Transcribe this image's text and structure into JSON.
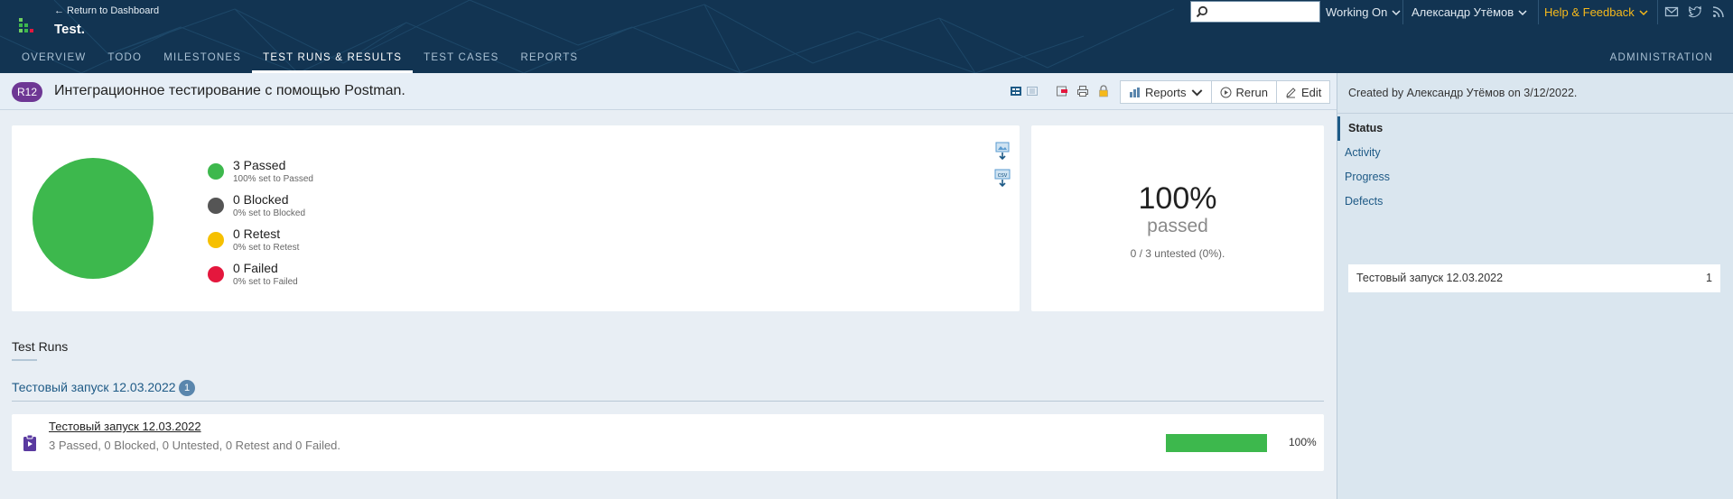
{
  "header": {
    "return_link": "← Return to Dashboard",
    "project_title": "Test.",
    "nav": [
      {
        "label": "OVERVIEW"
      },
      {
        "label": "TODO"
      },
      {
        "label": "MILESTONES"
      },
      {
        "label": "TEST RUNS & RESULTS"
      },
      {
        "label": "TEST CASES"
      },
      {
        "label": "REPORTS"
      }
    ],
    "active_nav": "TEST RUNS & RESULTS",
    "admin": "ADMINISTRATION",
    "search": {
      "value": "",
      "placeholder": ""
    },
    "working_on": "Working On",
    "user": "Александр Утёмов",
    "help": "Help & Feedback",
    "icons": [
      "mail-icon",
      "twitter-icon",
      "rss-icon"
    ]
  },
  "titlebar": {
    "badge": "R12",
    "title": "Интеграционное тестирование с помощью Postman.",
    "reports": "Reports",
    "rerun": "Rerun",
    "edit": "Edit"
  },
  "status_chart": {
    "legend": [
      {
        "label": "3 Passed",
        "sub": "100% set to Passed",
        "color": "#3db84d"
      },
      {
        "label": "0 Blocked",
        "sub": "0% set to Blocked",
        "color": "#555555"
      },
      {
        "label": "0 Retest",
        "sub": "0% set to Retest",
        "color": "#f6c000"
      },
      {
        "label": "0 Failed",
        "sub": "0% set to Failed",
        "color": "#e4173d"
      }
    ],
    "percent": "100%",
    "percent_label": "passed",
    "untested": "0 / 3 untested (0%)."
  },
  "chart_data": {
    "type": "pie",
    "categories": [
      "Passed",
      "Blocked",
      "Retest",
      "Failed"
    ],
    "values": [
      3,
      0,
      0,
      0
    ],
    "colors": [
      "#3db84d",
      "#555555",
      "#f6c000",
      "#e4173d"
    ]
  },
  "test_runs": {
    "section_title": "Test Runs",
    "group_title": "Тестовый запуск 12.03.2022",
    "group_count": "1",
    "items": [
      {
        "name": "Тестовый запуск 12.03.2022",
        "summary": "3 Passed, 0 Blocked, 0 Untested, 0 Retest and 0 Failed.",
        "progress": 1.0,
        "progress_label": "100%"
      }
    ]
  },
  "sidebar": {
    "created": "Created by Александр Утёмов on 3/12/2022.",
    "nav": [
      {
        "label": "Status"
      },
      {
        "label": "Activity"
      },
      {
        "label": "Progress"
      },
      {
        "label": "Defects"
      }
    ],
    "active_nav": "Status",
    "list": [
      {
        "label": "Тестовый запуск 12.03.2022",
        "count": "1"
      }
    ]
  }
}
